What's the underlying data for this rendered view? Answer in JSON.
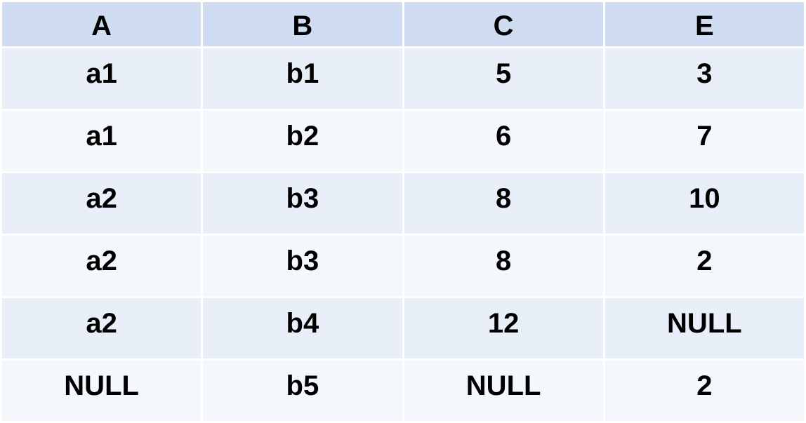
{
  "table": {
    "columns": [
      "A",
      "B",
      "C",
      "E"
    ],
    "rows": [
      [
        "a1",
        "b1",
        "5",
        "3"
      ],
      [
        "a1",
        "b2",
        "6",
        "7"
      ],
      [
        "a2",
        "b3",
        "8",
        "10"
      ],
      [
        "a2",
        "b3",
        "8",
        "2"
      ],
      [
        "a2",
        "b4",
        "12",
        "NULL"
      ],
      [
        "NULL",
        "b5",
        "NULL",
        "2"
      ]
    ]
  },
  "colors": {
    "header_bg": "#cfdcf1",
    "row_odd_bg": "#e9eff8",
    "row_even_bg": "#f4f7fc",
    "border": "#ffffff",
    "text": "#000000"
  }
}
